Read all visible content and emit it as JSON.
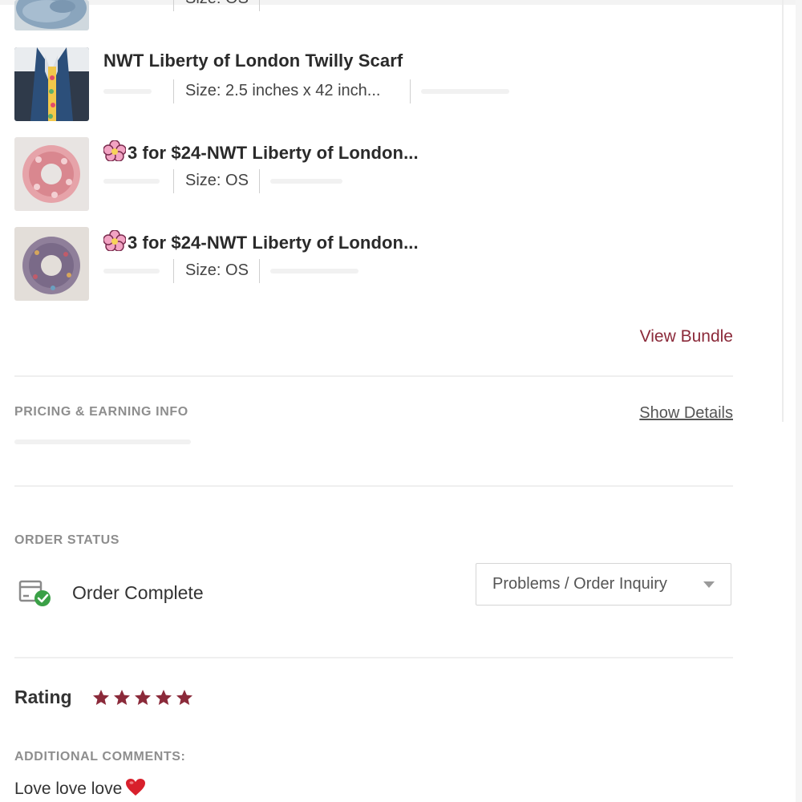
{
  "items": [
    {
      "title": "",
      "size": "Size: OS",
      "thumb_icon": "denim-scrunchie-photo"
    },
    {
      "title": "NWT Liberty of London Twilly Scarf",
      "size": "Size: 2.5 inches x 42 inch...",
      "thumb_icon": "scarf-photo"
    },
    {
      "title": "3 for $24-NWT Liberty of London...",
      "size": "Size: OS",
      "thumb_icon": "pink-scrunchie-photo",
      "prefix_icon": "flower-icon"
    },
    {
      "title": "3 for $24-NWT Liberty of London...",
      "size": "Size: OS",
      "thumb_icon": "purple-scrunchie-photo",
      "prefix_icon": "flower-icon"
    }
  ],
  "view_bundle_label": "View Bundle",
  "pricing": {
    "label": "PRICING & EARNING INFO",
    "show_details_label": "Show Details"
  },
  "order_status": {
    "label": "ORDER STATUS",
    "status_text": "Order Complete",
    "status_icon": "package-check-icon",
    "inquiry_button_label": "Problems / Order Inquiry"
  },
  "rating": {
    "label": "Rating",
    "stars": 5,
    "max_stars": 5
  },
  "comments": {
    "label": "ADDITIONAL COMMENTS:",
    "text": "Love love love",
    "emoji": "heart-icon"
  },
  "colors": {
    "accent": "#8b2a3a",
    "star": "#8b2a3a",
    "check": "#3aa046",
    "heart": "#d8202c"
  }
}
